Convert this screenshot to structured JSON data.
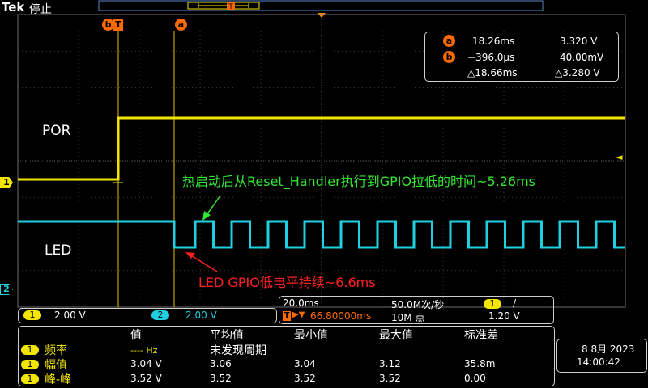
{
  "header": {
    "brand": "Tek",
    "status": "停止"
  },
  "cursor_markers": {
    "a": "a",
    "bT": "b",
    "T": "T"
  },
  "channel_markers": {
    "ch1": "1",
    "ch2": "2",
    "trigger": "◄"
  },
  "labels": {
    "por": "POR",
    "led": "LED"
  },
  "cursor_readout": {
    "a_time": "18.26ms",
    "a_volt": "3.320 V",
    "b_time": "−396.0μs",
    "b_volt": "40.00mV",
    "delta_time": "△18.66ms",
    "delta_volt": "△3.280 V"
  },
  "annotations": {
    "green": "热启动后从Reset_Handler执行到GPIO拉低的时间~5.26ms",
    "red": "LED GPIO低电平持续~6.6ms"
  },
  "channel_panel": {
    "ch1_num": "1",
    "ch1_scale": "2.00 V",
    "ch2_num": "2",
    "ch2_scale": "2.00 V"
  },
  "timebase": {
    "scale": "20.0ms",
    "samplerate": "50.0M次/秒",
    "trig_src": "1",
    "trig_slope": "/",
    "position_icon": "T",
    "position": "66.80000ms",
    "record": "10M 点",
    "trig_level": "1.20 V"
  },
  "measurements": {
    "headers": [
      "值",
      "平均值",
      "最小值",
      "最大值",
      "标准差"
    ],
    "rows": [
      {
        "ch": "1",
        "name": "频率",
        "value": "---- Hz",
        "mean": "未发现周期",
        "min": "",
        "max": "",
        "std": ""
      },
      {
        "ch": "1",
        "name": "幅值",
        "value": "3.04 V",
        "mean": "3.06",
        "min": "3.04",
        "max": "3.12",
        "std": "35.8m"
      },
      {
        "ch": "1",
        "name": "峰-峰",
        "value": "3.52 V",
        "mean": "3.52",
        "min": "3.52",
        "max": "3.52",
        "std": "0.00"
      }
    ]
  },
  "datetime": {
    "date": "8 8月 2023",
    "time": "14:00:42"
  },
  "colors": {
    "ch1": "#f2e600",
    "ch2": "#1fd0e0",
    "cursor": "#ff6a00",
    "annot_green": "#33e633",
    "annot_red": "#ff2020"
  }
}
